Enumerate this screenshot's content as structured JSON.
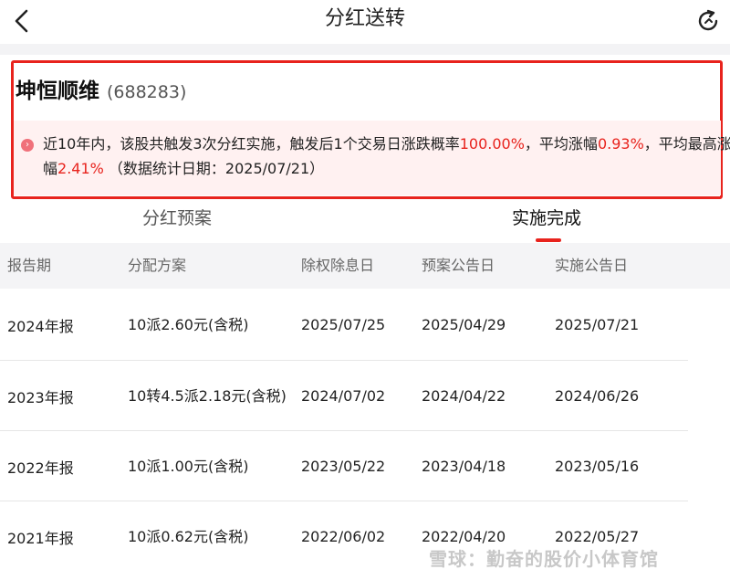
{
  "header": {
    "title": "分红送转"
  },
  "stock": {
    "name": "坤恒顺维",
    "code": "(688283)"
  },
  "stats": {
    "part1": "近10年内，该股共触发3次分红实施，触发后1个交易日涨跌概率",
    "probability": "100.00%",
    "part2": "，平均涨幅",
    "avg_gain": "0.93%",
    "part3": "，平均最高涨幅",
    "max_gain": "2.41%",
    "part4": " （数据统计日期：2025/07/21）"
  },
  "tabs": {
    "plan": "分红预案",
    "done": "实施完成",
    "active": "done"
  },
  "table": {
    "headers": [
      "报告期",
      "分配方案",
      "除权除息日",
      "预案公告日",
      "实施公告日"
    ],
    "rows": [
      [
        "2024年报",
        "10派2.60元(含税)",
        "2025/07/25",
        "2025/04/29",
        "2025/07/21"
      ],
      [
        "2023年报",
        "10转4.5派2.18元(含税)",
        "2024/07/02",
        "2024/04/22",
        "2024/06/26"
      ],
      [
        "2022年报",
        "10派1.00元(含税)",
        "2023/05/22",
        "2023/04/18",
        "2023/05/16"
      ],
      [
        "2021年报",
        "10派0.62元(含税)",
        "2022/06/02",
        "2022/04/20",
        "2022/05/27"
      ]
    ]
  },
  "watermark": "雪球：勤奋的股价小体育馆",
  "colors": {
    "accent": "#e8231d",
    "panel_bg": "#fff1f1"
  },
  "icons": {
    "back": "chevron-left-icon",
    "refresh": "refresh-icon"
  }
}
